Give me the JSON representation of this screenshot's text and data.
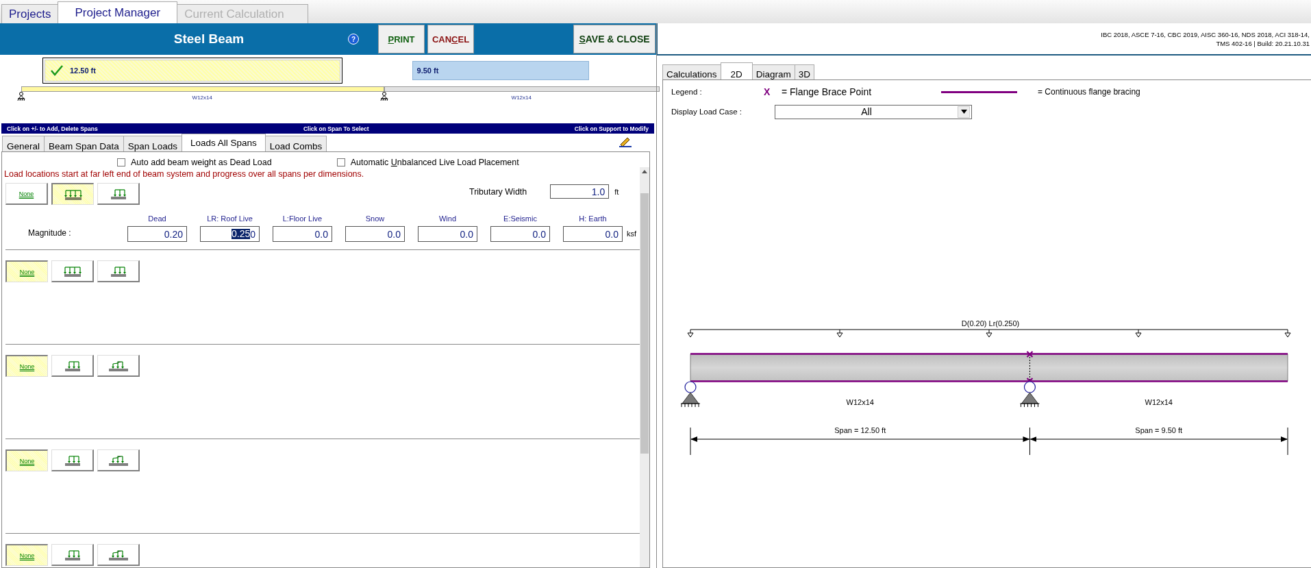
{
  "top_tabs": [
    {
      "label": "Projects",
      "selected": false,
      "disabled": false
    },
    {
      "label": "Project Manager",
      "selected": true,
      "disabled": false
    },
    {
      "label": "Current Calculation",
      "selected": false,
      "disabled": true
    }
  ],
  "header": {
    "title": "Steel Beam",
    "help": "?",
    "buttons": [
      {
        "kind": "print",
        "accel": "P",
        "after": "RINT"
      },
      {
        "kind": "cancel",
        "before": "CAN",
        "accel": "C",
        "after": "EL"
      },
      {
        "kind": "save",
        "accel": "S",
        "after": "AVE & CLOSE"
      }
    ]
  },
  "codes": [
    "IBC 2018, ASCE 7-16, CBC 2019, AISC 360-16, NDS 2018, ACI 318-14,",
    "TMS 402-16 | Build: 20.21.10.31"
  ],
  "spans": [
    {
      "length": "12.50 ft",
      "section": "W12x14",
      "selected": true
    },
    {
      "length": "9.50 ft",
      "section": "W12x14",
      "selected": false
    }
  ],
  "info_bar": [
    "Click on  +/-  to Add, Delete Spans",
    "Click on Span To Select",
    "Click on Support to Modify"
  ],
  "sub_tabs": [
    {
      "label": "General",
      "selected": false
    },
    {
      "label": "Beam Span Data",
      "selected": false
    },
    {
      "label": "Span Loads",
      "selected": false
    },
    {
      "label": "Loads All Spans",
      "selected": true
    },
    {
      "label": "Load Combs",
      "selected": false
    }
  ],
  "options": [
    {
      "before": "Auto add beam weight as Dead Load",
      "checked": false
    },
    {
      "before": "Automatic ",
      "accel": "U",
      "after": "nbalanced Live Load Placement",
      "checked": false
    }
  ],
  "note": "Load locations start at far left end of beam system and progress over all spans per dimensions.",
  "tributary": {
    "label": "Tributary Width",
    "value": "1.0",
    "unit": "ft"
  },
  "magnitude": {
    "label": "Magnitude :",
    "unit": "ksf",
    "cases": [
      {
        "label": "Dead",
        "parts": [
          {
            "text": "0.20",
            "selected": false
          }
        ]
      },
      {
        "label": "LR: Roof Live",
        "parts": [
          {
            "text": "0.25",
            "selected": true
          },
          {
            "text": "0",
            "selected": false
          }
        ]
      },
      {
        "label": "L:Floor Live",
        "parts": [
          {
            "text": "0.0",
            "selected": false
          }
        ]
      },
      {
        "label": "Snow",
        "parts": [
          {
            "text": "0.0",
            "selected": false
          }
        ]
      },
      {
        "label": "Wind",
        "parts": [
          {
            "text": "0.0",
            "selected": false
          }
        ]
      },
      {
        "label": "E:Seismic",
        "parts": [
          {
            "text": "0.0",
            "selected": false
          }
        ]
      },
      {
        "label": "H: Earth",
        "parts": [
          {
            "text": "0.0",
            "selected": false
          }
        ]
      }
    ]
  },
  "load_sections": [
    {
      "buttons": [
        {
          "kind": "none",
          "label": "None",
          "selected": false
        },
        {
          "kind": "uniform",
          "selected": true
        },
        {
          "kind": "partial",
          "selected": false
        }
      ]
    },
    {
      "buttons": [
        {
          "kind": "none",
          "label": "None",
          "selected": true
        },
        {
          "kind": "uniform",
          "selected": false
        },
        {
          "kind": "partial",
          "selected": false
        }
      ]
    },
    {
      "buttons": [
        {
          "kind": "none",
          "label": "None",
          "selected": true
        },
        {
          "kind": "partial",
          "selected": false
        },
        {
          "kind": "trapezoid",
          "selected": false
        }
      ]
    },
    {
      "buttons": [
        {
          "kind": "none",
          "label": "None",
          "selected": true
        },
        {
          "kind": "partial",
          "selected": false
        },
        {
          "kind": "trapezoid",
          "selected": false
        }
      ]
    },
    {
      "buttons": [
        {
          "kind": "none",
          "label": "None",
          "selected": true
        },
        {
          "kind": "partial",
          "selected": false
        },
        {
          "kind": "trapezoid",
          "selected": false
        }
      ]
    }
  ],
  "view_tabs": [
    {
      "label": "Calculations",
      "selected": false
    },
    {
      "label": "2D",
      "selected": true
    },
    {
      "label": "Diagram",
      "selected": false
    },
    {
      "label": "3D",
      "selected": false
    }
  ],
  "legend": {
    "label": "Legend :",
    "brace_symbol": "X",
    "brace_text": "= Flange Brace Point",
    "continuous_text": "= Continuous flange bracing"
  },
  "load_case": {
    "label": "Display Load Case :",
    "value": "All"
  },
  "diagram": {
    "load_label": "D(0.20) Lr(0.250)",
    "spans": [
      {
        "section": "W12x14",
        "dimension": "Span = 12.50 ft"
      },
      {
        "section": "W12x14",
        "dimension": "Span = 9.50 ft"
      }
    ]
  }
}
